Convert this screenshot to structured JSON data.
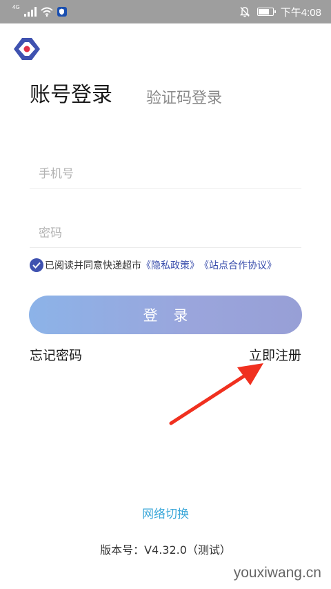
{
  "status_bar": {
    "network": "4G",
    "time": "下午4:08",
    "battery_level": 0.8,
    "icons": [
      "signal-icon",
      "wifi-icon",
      "shield-icon",
      "mute-bell-icon",
      "battery-icon"
    ]
  },
  "login": {
    "tab_account": "账号登录",
    "tab_sms": "验证码登录",
    "phone_placeholder": "手机号",
    "password_placeholder": "密码",
    "agree_text": "已阅读并同意快递超市",
    "privacy_link": "《隐私政策》",
    "site_link": "《站点合作协议》",
    "login_button": "登 录",
    "forgot_password": "忘记密码",
    "register": "立即注册"
  },
  "footer": {
    "network_switch": "网络切换",
    "version": "版本号：V4.32.0（测试）"
  },
  "watermark": "youxiwang.cn",
  "colors": {
    "status_bar_bg": "#9e9e9e",
    "brand_blue": "#3f52b0",
    "brand_red": "#e03148",
    "link_blue": "#3b4fad",
    "network_link": "#3aa7d9",
    "button_gradient_start": "#8cb3e8",
    "button_gradient_end": "#979fd6",
    "annotation_arrow": "#f0301f"
  }
}
